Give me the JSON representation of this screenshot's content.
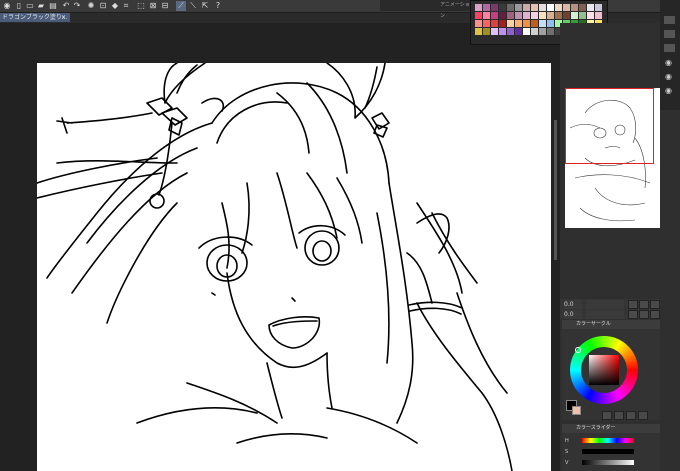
{
  "document_tab": {
    "title": "ドラゴンブラック塗り...",
    "close": "×"
  },
  "palette_header": "アニメーション",
  "palette_colors": [
    "#d9a0c8",
    "#b06aa0",
    "#7a3a6a",
    "#3a3a3a",
    "#6a6a6a",
    "#9a9a9a",
    "#caa",
    "#e8c0b0",
    "#e0e0e0",
    "#ffffff",
    "#f0d8c8",
    "#d8b8a8",
    "#b89080",
    "#806050",
    "#e8e8f0",
    "#c8c8d8",
    "#ff4060",
    "#ff80a0",
    "#c04080",
    "#602040",
    "#a06080",
    "#c090b0",
    "#e0b0d0",
    "#f0d0e0",
    "#f8e0c0",
    "#d8b090",
    "#a07050",
    "#704030",
    "#d0f0d0",
    "#90c090",
    "#ffe0e8",
    "#f0c0d0",
    "#ff9090",
    "#ff6060",
    "#e04040",
    "#a02020",
    "#ffd0a0",
    "#ffb070",
    "#f09040",
    "#c06020",
    "#c0e0ff",
    "#90c0f0",
    "#a0ffa0",
    "#60d060",
    "#30a030",
    "#207020",
    "#fff0a0",
    "#ffe060",
    "#e0c040",
    "#a09020",
    "#e0c0ff",
    "#c090f0",
    "#9060d0",
    "#6030a0",
    "#ffffff",
    "#d0d0d0",
    "#a0a0a0",
    "#707070",
    "#404040",
    "#202020",
    "#b0a080",
    "#807050",
    "#705040",
    "#403020"
  ],
  "color_wheel": {
    "label": "カラーサークル",
    "hue": "red"
  },
  "color_slider": {
    "label": "カラースライダー",
    "h": "H",
    "s": "S",
    "v": "V"
  },
  "zoom": {
    "value": "0.0",
    "zoom2": "0.0"
  }
}
